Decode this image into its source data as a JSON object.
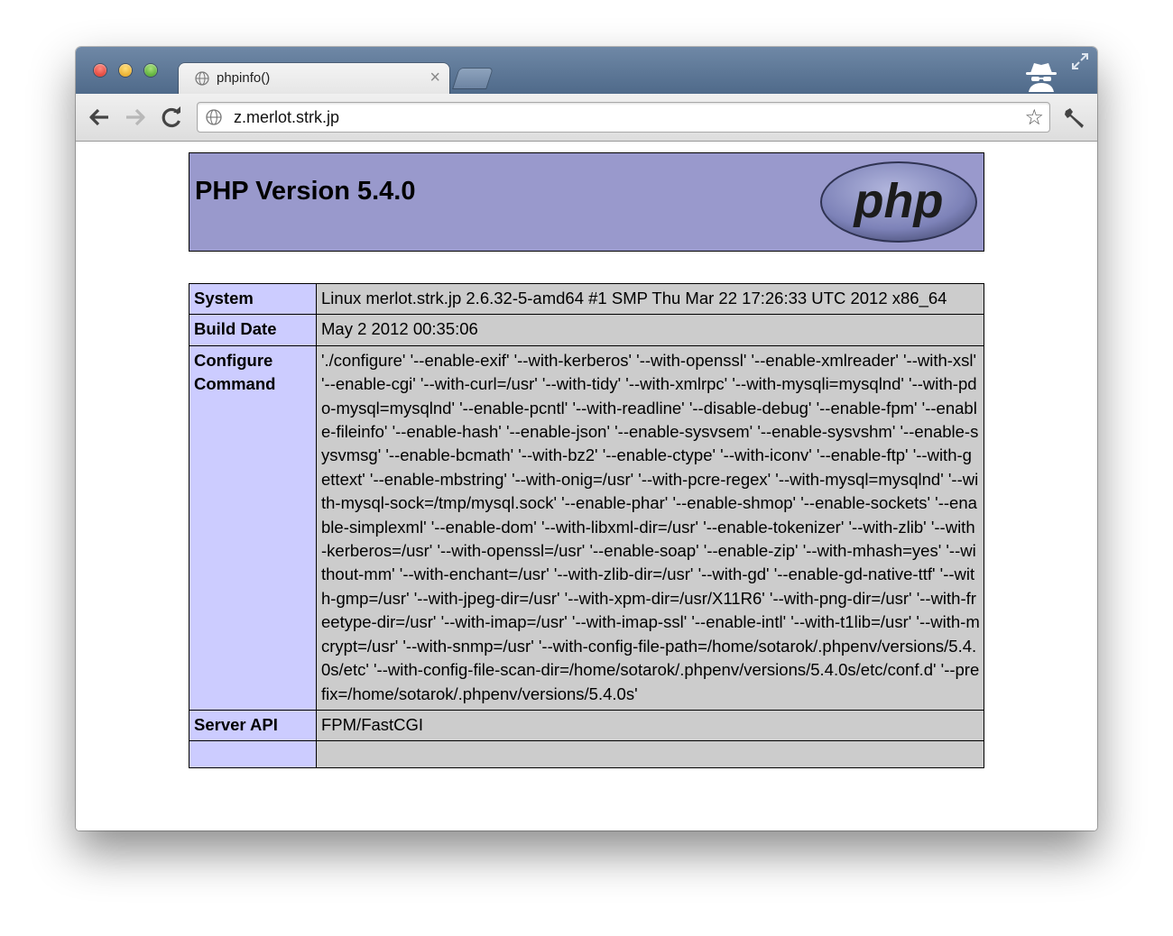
{
  "browser": {
    "tab": {
      "title": "phpinfo()",
      "close_glyph": "×",
      "icon": "globe-icon"
    },
    "omnibox": {
      "url": "z.merlot.strk.jp",
      "icon": "globe-icon",
      "bookmark_glyph": "☆"
    },
    "nav": {
      "back_glyph": "←",
      "forward_glyph": "→",
      "reload_icon": "reload-icon"
    },
    "incognito_icon": "incognito-icon",
    "wrench_icon": "wrench-icon",
    "fullscreen_icon": "fullscreen-icon",
    "colors": {
      "frame": "#5a7596",
      "tab": "#ececec",
      "toolbar": "#e6e6e6"
    }
  },
  "page": {
    "title": "PHP Version 5.4.0",
    "logo_text": "php",
    "colors": {
      "header": "#9999cc",
      "label_cell": "#ccccff",
      "value_cell": "#cccccc"
    },
    "rows": [
      {
        "label": "System",
        "value": "Linux merlot.strk.jp 2.6.32-5-amd64 #1 SMP Thu Mar 22 17:26:33 UTC 2012 x86_64"
      },
      {
        "label": "Build Date",
        "value": "May 2 2012 00:35:06"
      },
      {
        "label": "Configure Command",
        "value": "'./configure' '--enable-exif' '--with-kerberos' '--with-openssl' '--enable-xmlreader' '--with-xsl' '--enable-cgi' '--with-curl=/usr' '--with-tidy' '--with-xmlrpc' '--with-mysqli=mysqlnd' '--with-pdo-mysql=mysqlnd' '--enable-pcntl' '--with-readline' '--disable-debug' '--enable-fpm' '--enable-fileinfo' '--enable-hash' '--enable-json' '--enable-sysvsem' '--enable-sysvshm' '--enable-sysvmsg' '--enable-bcmath' '--with-bz2' '--enable-ctype' '--with-iconv' '--enable-ftp' '--with-gettext' '--enable-mbstring' '--with-onig=/usr' '--with-pcre-regex' '--with-mysql=mysqlnd' '--with-mysql-sock=/tmp/mysql.sock' '--enable-phar' '--enable-shmop' '--enable-sockets' '--enable-simplexml' '--enable-dom' '--with-libxml-dir=/usr' '--enable-tokenizer' '--with-zlib' '--with-kerberos=/usr' '--with-openssl=/usr' '--enable-soap' '--enable-zip' '--with-mhash=yes' '--without-mm' '--with-enchant=/usr' '--with-zlib-dir=/usr' '--with-gd' '--enable-gd-native-ttf' '--with-gmp=/usr' '--with-jpeg-dir=/usr' '--with-xpm-dir=/usr/X11R6' '--with-png-dir=/usr' '--with-freetype-dir=/usr' '--with-imap=/usr' '--with-imap-ssl' '--enable-intl' '--with-t1lib=/usr' '--with-mcrypt=/usr' '--with-snmp=/usr' '--with-config-file-path=/home/sotarok/.phpenv/versions/5.4.0s/etc' '--with-config-file-scan-dir=/home/sotarok/.phpenv/versions/5.4.0s/etc/conf.d' '--prefix=/home/sotarok/.phpenv/versions/5.4.0s'"
      },
      {
        "label": "Server API",
        "value": "FPM/FastCGI"
      },
      {
        "label": "",
        "value": ""
      }
    ]
  }
}
